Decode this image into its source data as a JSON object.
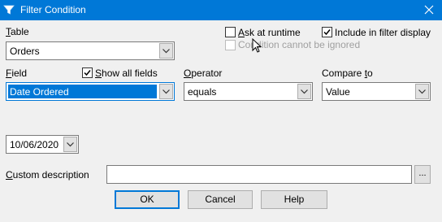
{
  "window": {
    "title": "Filter Condition",
    "title_icon": "filter-funnel-icon",
    "close_icon": "close-icon"
  },
  "table": {
    "label": "Table",
    "value": "Orders"
  },
  "options": {
    "ask_at_runtime_label": "Ask at runtime",
    "ask_at_runtime_checked": false,
    "include_in_filter_display_label": "Include in filter display",
    "include_in_filter_display_checked": true,
    "condition_cannot_be_ignored_label": "Condition cannot be ignored",
    "condition_cannot_be_ignored_checked": false,
    "condition_cannot_be_ignored_enabled": false
  },
  "field": {
    "label": "Field",
    "show_all_fields_label": "Show all fields",
    "show_all_fields_checked": true,
    "value": "Date Ordered"
  },
  "operator": {
    "label": "Operator",
    "value": "equals"
  },
  "compare_to": {
    "label": "Compare to",
    "value": "Value"
  },
  "date_value": "10/06/2020",
  "custom_description": {
    "label": "Custom description",
    "value": "",
    "browse_label": "..."
  },
  "buttons": {
    "ok": "OK",
    "cancel": "Cancel",
    "help": "Help"
  },
  "colors": {
    "accent": "#0078d7",
    "window_bg": "#f0f0f0"
  }
}
